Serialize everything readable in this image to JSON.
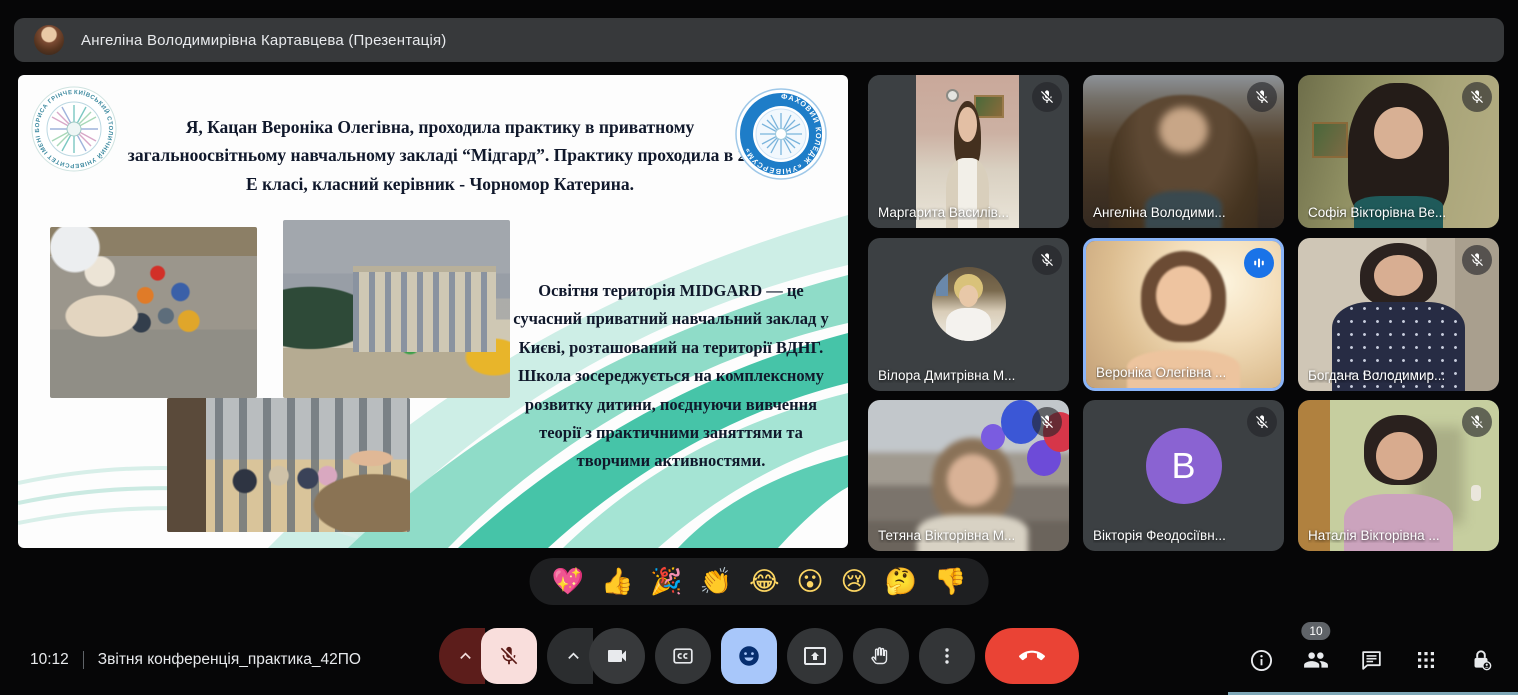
{
  "top_bar": {
    "title": "Ангеліна Володимирівна Картавцева (Презентація)"
  },
  "slide": {
    "intro": "Я, Кацан Вероніка Олегівна, проходила практику в приватному загальноосвітньому навчальному закладі “Мідгард”. Практику проходила в 2-Е класі, класний керівник - Чорномор Катерина.",
    "body": "Освітня територія MIDGARD — це сучасний приватний навчальний заклад у Києві, розташований на території ВДНГ. Школа зосереджується на комплексному розвитку дитини, поєднуючи вивчення теорії з практичними заняттями та творчими активностями.",
    "left_logo_text": "КИЇВСЬКИЙ СТОЛИЧНИЙ УНІВЕРСИТЕТ ІМЕНІ БОРИСА ГРІНЧЕНКА",
    "right_logo_text": "ФАХОВИЙ КОЛЕДЖ «УНІВЕРСУМ»"
  },
  "participants": [
    {
      "name": "Маргарита Василів...",
      "muted": true
    },
    {
      "name": "Ангеліна Володими...",
      "muted": true
    },
    {
      "name": "Софія Вікторівна Ве...",
      "muted": true
    },
    {
      "name": "Вілора Дмитрівна М...",
      "muted": true
    },
    {
      "name": "Вероніка Олегівна ...",
      "muted": false,
      "speaking": true
    },
    {
      "name": "Богдана Володимир...",
      "muted": true
    },
    {
      "name": "Тетяна Вікторівна М...",
      "muted": true
    },
    {
      "name": "Вікторія Феодосіївн...",
      "muted": true,
      "avatar_letter": "B"
    },
    {
      "name": "Наталія Вікторівна ...",
      "muted": true
    }
  ],
  "reactions": {
    "emojis": [
      "💖",
      "👍",
      "🎉",
      "👏",
      "😂",
      "😮",
      "😢",
      "🤔",
      "👎"
    ]
  },
  "bottom_bar": {
    "time": "10:12",
    "meeting_name": "Звітня конференція_практика_42ПО",
    "participants_badge": "10"
  },
  "colors": {
    "active_speaker_border": "#8ab4f8",
    "audio_indicator": "#1a73e8",
    "end_call": "#ea4335",
    "mic_muted_bg": "#f9dedc",
    "reactions_active_bg": "#a8c7fa"
  }
}
